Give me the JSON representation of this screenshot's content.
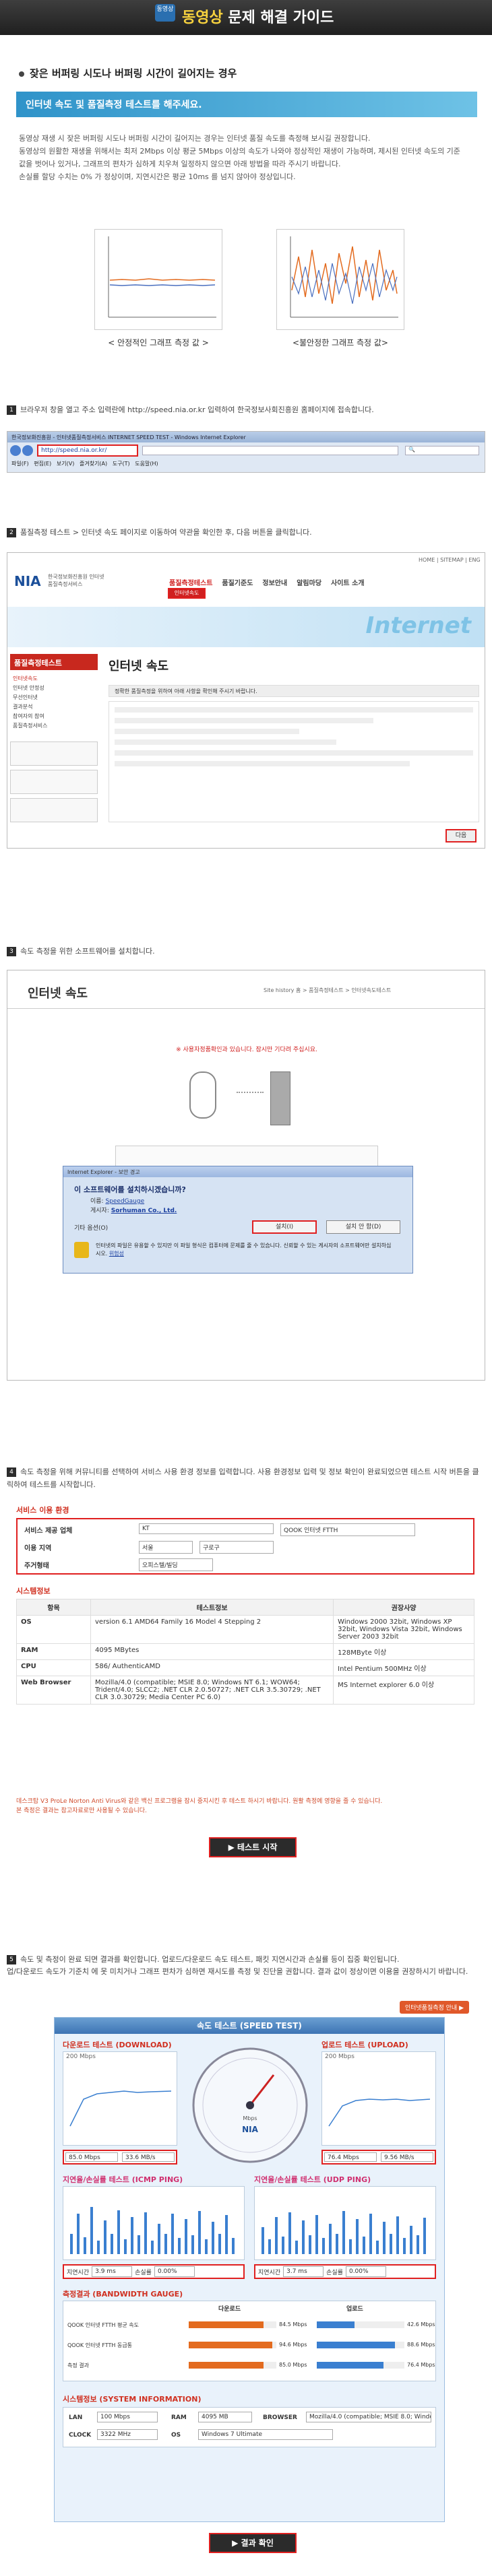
{
  "header": {
    "badge": "동영상",
    "title_accent": "동영상",
    "title_rest": " 문제 해결 가이드"
  },
  "intro": {
    "question": "잦은 버퍼링 시도나 버퍼링 시간이 길어지는 경우",
    "banner": "인터넷 속도 및 품질측정 테스트를 해주세요.",
    "p1": "동영상 재생 시 잦은 버퍼링 시도나 버퍼링 시간이 길어지는 경우는 인터넷 품질 속도를 측정해 보시길 권장합니다.",
    "p2": "동영상의 원활한 재생을 위해서는 최저 2Mbps 이상 평균 5Mbps 이상의 속도가 나와야 정상적인 재생이 가능하며, 제시된 인터넷 속도의 기준값을 벗어나 있거나, 그래프의 편차가 심하게 치우쳐 일정하지 않으면 아래 방법을 따라 주시기 바랍니다.",
    "p3": "손실률 할당 수치는 0% 가 정상이며, 지연시간은 평균 10ms 를 넘지 않아야 정상입니다.",
    "caption_stable": "< 안정적인 그래프 측정 값 >",
    "caption_unstable": "<불안정한 그래프 측정 값>"
  },
  "step1": {
    "num": "1",
    "text": "브라우저 창을 열고 주소 입력란에 http://speed.nia.or.kr 입력하여 한국정보사회진흥원 홈페이지에 접속합니다.",
    "browser_title": "한국정보화진흥원 - 인터넷품질측정서비스 INTERNET SPEED TEST - Windows Internet Explorer",
    "address": "http://speed.nia.or.kr/",
    "menu": [
      "파일(F)",
      "편집(E)",
      "보기(V)",
      "즐겨찾기(A)",
      "도구(T)",
      "도움말(H)"
    ]
  },
  "step2": {
    "num": "2",
    "text": "품질측정 테스트 > 인터넷 속도 페이지로 이동하여 약관을 확인한 후, 다음 버튼을 클릭합니다.",
    "site_logo": "NIA",
    "site_name": "한국정보화진흥원 인터넷 품질측정서비스",
    "top_links": [
      "HOME",
      "SITEMAP",
      "ENG"
    ],
    "nav": [
      "품질측정테스트",
      "품질기준도",
      "정보안내",
      "알림마당",
      "사이트 소개"
    ],
    "nav_sub": "인터넷속도",
    "left_title": "품질측정테스트",
    "left_menu": [
      "인터넷속도",
      "인터넷 안정성",
      "무선인터넷",
      "결과분석",
      "참여자의 참여",
      "품질측정서비스"
    ],
    "page_heading": "인터넷 속도",
    "notice": "정확한 품질측정을 위하여 아래 사항을 확인해 주시기 바랍니다.",
    "next_btn": "다음"
  },
  "step3": {
    "num": "3",
    "text": "속도 측정을 위한 소프트웨어를 설치합니다.",
    "page_heading": "인터넷 속도",
    "breadcrumb": "Site history 홈 > 품질측정테스트 > 인터넷속도테스트",
    "red_notice": "※ 사용자정품확인과 있습니다. 잠시만 기다려 주십시요.",
    "dialog_title": "Internet Explorer - 보안 경고",
    "dialog_question": "이 소프트웨어를 설치하시겠습니까?",
    "name_label": "이름:",
    "name_value": "SpeedGauge",
    "publisher_label": "게시자:",
    "publisher_value": "Sorhuman Co., Ltd.",
    "options": "기타 옵션(O)",
    "install_btn": "설치(I)",
    "noinstall_btn": "설치 안 함(D)",
    "warning": "인터넷의 파일은 유용할 수 있지만 이 파일 형식은 컴퓨터에 문제를 줄 수 있습니다. 신뢰할 수 있는 게시자의 소프트웨어만 설치하십시오.",
    "risk_link": "위험성"
  },
  "step4": {
    "num": "4",
    "text": "속도 측정을 위해 커뮤니티를 선택하여 서비스 사용 환경 정보를 입력합니다. 사용 환경정보 입력 및 정보 확인이 완료되었으면 테스트 시작 버튼을 클릭하여 테스트를 시작합니다.",
    "env_title": "서비스 이용 환경",
    "env_rows": [
      {
        "label": "서비스 제공 업체",
        "value1": "KT",
        "value2": "QOOK 인터넷 FTTH"
      },
      {
        "label": "이용 지역",
        "value1": "서울",
        "value2": "구로구"
      },
      {
        "label": "주거형태",
        "value1": "오피스텔/빌딩",
        "value2": ""
      }
    ],
    "sys_title": "시스템정보",
    "sys_headers": [
      "항목",
      "테스트정보",
      "권장사양"
    ],
    "sys_rows": [
      {
        "item": "OS",
        "test": "version 6.1 AMD64 Family 16 Model 4 Stepping 2",
        "rec": "Windows 2000 32bit, Windows XP 32bit, Windows Vista 32bit, Windows Server 2003 32bit"
      },
      {
        "item": "RAM",
        "test": "4095 MBytes",
        "rec": "128MByte 이상"
      },
      {
        "item": "CPU",
        "test": "586/ AuthenticAMD",
        "rec": "Intel Pentium 500MHz 이상"
      },
      {
        "item": "Web Browser",
        "test": "Mozilla/4.0 (compatible; MSIE 8.0; Windows NT 6.1; WOW64; Trident/4.0; SLCC2; .NET CLR 2.0.50727; .NET CLR 3.5.30729; .NET CLR 3.0.30729; Media Center PC 6.0)",
        "rec": "MS Internet explorer 6.0 이상"
      }
    ],
    "note1": "데스크탑 V3 ProLe Norton Anti Virus와 같은 백신 프로그램을 잠시 중지시킨 후 테스트 하시기 바랍니다. 원활 측정에 영향을 줄 수 있습니다.",
    "note2": "본 측정은 결과는 참고자료로만 사용될 수 있습니다.",
    "start_btn": "▶ 테스트 시작"
  },
  "step5": {
    "num": "5",
    "text": "속도 및 측정이 완료 되면 결과를 확인합니다. 업로드/다운로드 속도 테스트, 패킷 지연시간과 손실률 등이 집중 확인됩니다.",
    "text2": "업/다운로드 속도가 기준치 에 못 미치거나 그래프 편차가 심하면 재시도를 측정 및 진단을 권합니다. 결과 값이 정상이면 이용을 권장하시기 바랍니다.",
    "corner_label": "인터넷품질측정 안내 ▶",
    "panel_title": "속도 테스트 (SPEED TEST)",
    "download_title": "다운로드 테스트 (DOWNLOAD)",
    "upload_title": "업로드 테스트 (UPLOAD)",
    "download_axis": "200 Mbps",
    "upload_axis": "200 Mbps",
    "download_values": [
      "85.0 Mbps",
      "33.6 MB/s"
    ],
    "upload_values": [
      "76.4 Mbps",
      "9.56 MB/s"
    ],
    "gauge_label": "NIA",
    "gauge_unit": "Mbps",
    "icmp_title": "지연율/손실률 테스트 (ICMP PING)",
    "udp_title": "지연율/손실률 테스트 (UDP PING)",
    "icmp_delay_label": "지연시간",
    "icmp_delay": "3.9 ms",
    "icmp_loss_label": "손실률",
    "icmp_loss": "0.00%",
    "udp_delay_label": "지연시간",
    "udp_delay": "3.7 ms",
    "udp_loss_label": "손실률",
    "udp_loss": "0.00%",
    "bandwidth_title": "측정결과 (BANDWIDTH GAUGE)",
    "bw_headers": [
      "다운로드",
      "업로드"
    ],
    "bw_rows": [
      {
        "label": "QOOK 인터넷 FTTH 평균 속도",
        "down": "84.5 Mbps",
        "up": "42.6 Mbps",
        "down_pct": 0.85,
        "up_pct": 0.43
      },
      {
        "label": "QOOK 인터넷 FTTH 동급통",
        "down": "94.6 Mbps",
        "up": "88.6 Mbps",
        "down_pct": 0.95,
        "up_pct": 0.89
      },
      {
        "label": "측정 결과",
        "down": "85.0 Mbps",
        "up": "76.4 Mbps",
        "down_pct": 0.85,
        "up_pct": 0.76
      }
    ],
    "sysinfo_title": "시스템정보 (SYSTEM INFORMATION)",
    "sysinfo": [
      {
        "k": "LAN",
        "v": "100 Mbps"
      },
      {
        "k": "RAM",
        "v": "4095 MB"
      },
      {
        "k": "BROWSER",
        "v": "Mozilla/4.0 (compatible; MSIE 8.0; Window"
      },
      {
        "k": "CLOCK",
        "v": "3322 MHz"
      },
      {
        "k": "OS",
        "v": "Windows 7 Ultimate"
      }
    ],
    "result_btn": "▶ 결과 확인"
  }
}
